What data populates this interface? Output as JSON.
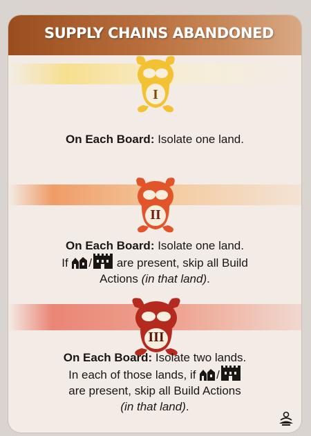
{
  "card": {
    "title": "SUPPLY CHAINS ABANDONED",
    "colors": {
      "stage1": "#f2c232",
      "stage2": "#e2552a",
      "stage3": "#b52a1e",
      "title_bar": "#a8582a"
    },
    "stages": [
      {
        "numeral": "I",
        "label": "On Each Board:",
        "text": " Isolate one land."
      },
      {
        "numeral": "II",
        "label": "On Each Board:",
        "line1": " Isolate one land.",
        "if_prefix": "If ",
        "slash": "/",
        "line2_suffix": " are present, skip all Build",
        "line3_plain": "Actions ",
        "line3_italic": "(in that land)",
        "line3_end": "."
      },
      {
        "numeral": "III",
        "label": "On Each Board:",
        "line1": " Isolate two lands.",
        "line2_prefix": "In each of those lands, if ",
        "slash": "/",
        "line3": "are present, skip all Build Actions",
        "line4_italic": "(in that land)",
        "line4_end": "."
      }
    ]
  }
}
